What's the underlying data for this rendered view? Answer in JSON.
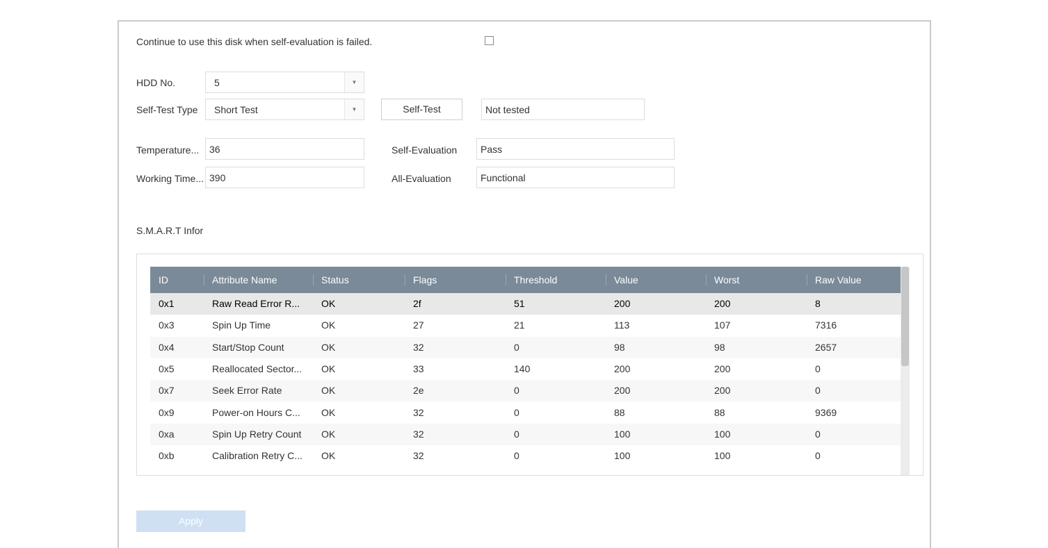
{
  "settings": {
    "continue_label": "Continue to use this disk when self-evaluation is failed.",
    "continue_checked": false,
    "hdd_no_label": "HDD No.",
    "hdd_no_value": "5",
    "self_test_type_label": "Self-Test Type",
    "self_test_type_value": "Short Test",
    "self_test_button": "Self-Test",
    "test_status": "Not tested",
    "temperature_label": "Temperature...",
    "temperature_value": "36",
    "working_time_label": "Working Time...",
    "working_time_value": "390",
    "self_evaluation_label": "Self-Evaluation",
    "self_evaluation_value": "Pass",
    "all_evaluation_label": "All-Evaluation",
    "all_evaluation_value": "Functional"
  },
  "smart": {
    "title": "S.M.A.R.T Infor",
    "columns": [
      "ID",
      "Attribute Name",
      "Status",
      "Flags",
      "Threshold",
      "Value",
      "Worst",
      "Raw Value"
    ],
    "rows": [
      [
        "0x1",
        "Raw Read Error R...",
        "OK",
        "2f",
        "51",
        "200",
        "200",
        "8"
      ],
      [
        "0x3",
        "Spin Up Time",
        "OK",
        "27",
        "21",
        "113",
        "107",
        "7316"
      ],
      [
        "0x4",
        "Start/Stop Count",
        "OK",
        "32",
        "0",
        "98",
        "98",
        "2657"
      ],
      [
        "0x5",
        "Reallocated Sector...",
        "OK",
        "33",
        "140",
        "200",
        "200",
        "0"
      ],
      [
        "0x7",
        "Seek Error Rate",
        "OK",
        "2e",
        "0",
        "200",
        "200",
        "0"
      ],
      [
        "0x9",
        "Power-on Hours C...",
        "OK",
        "32",
        "0",
        "88",
        "88",
        "9369"
      ],
      [
        "0xa",
        "Spin Up Retry Count",
        "OK",
        "32",
        "0",
        "100",
        "100",
        "0"
      ],
      [
        "0xb",
        "Calibration Retry C...",
        "OK",
        "32",
        "0",
        "100",
        "100",
        "0"
      ]
    ],
    "selected_row": 0
  },
  "footer": {
    "apply_label": "Apply"
  },
  "colors": {
    "header_bg": "#7a8a99",
    "apply_bg": "#cfe0f3"
  }
}
